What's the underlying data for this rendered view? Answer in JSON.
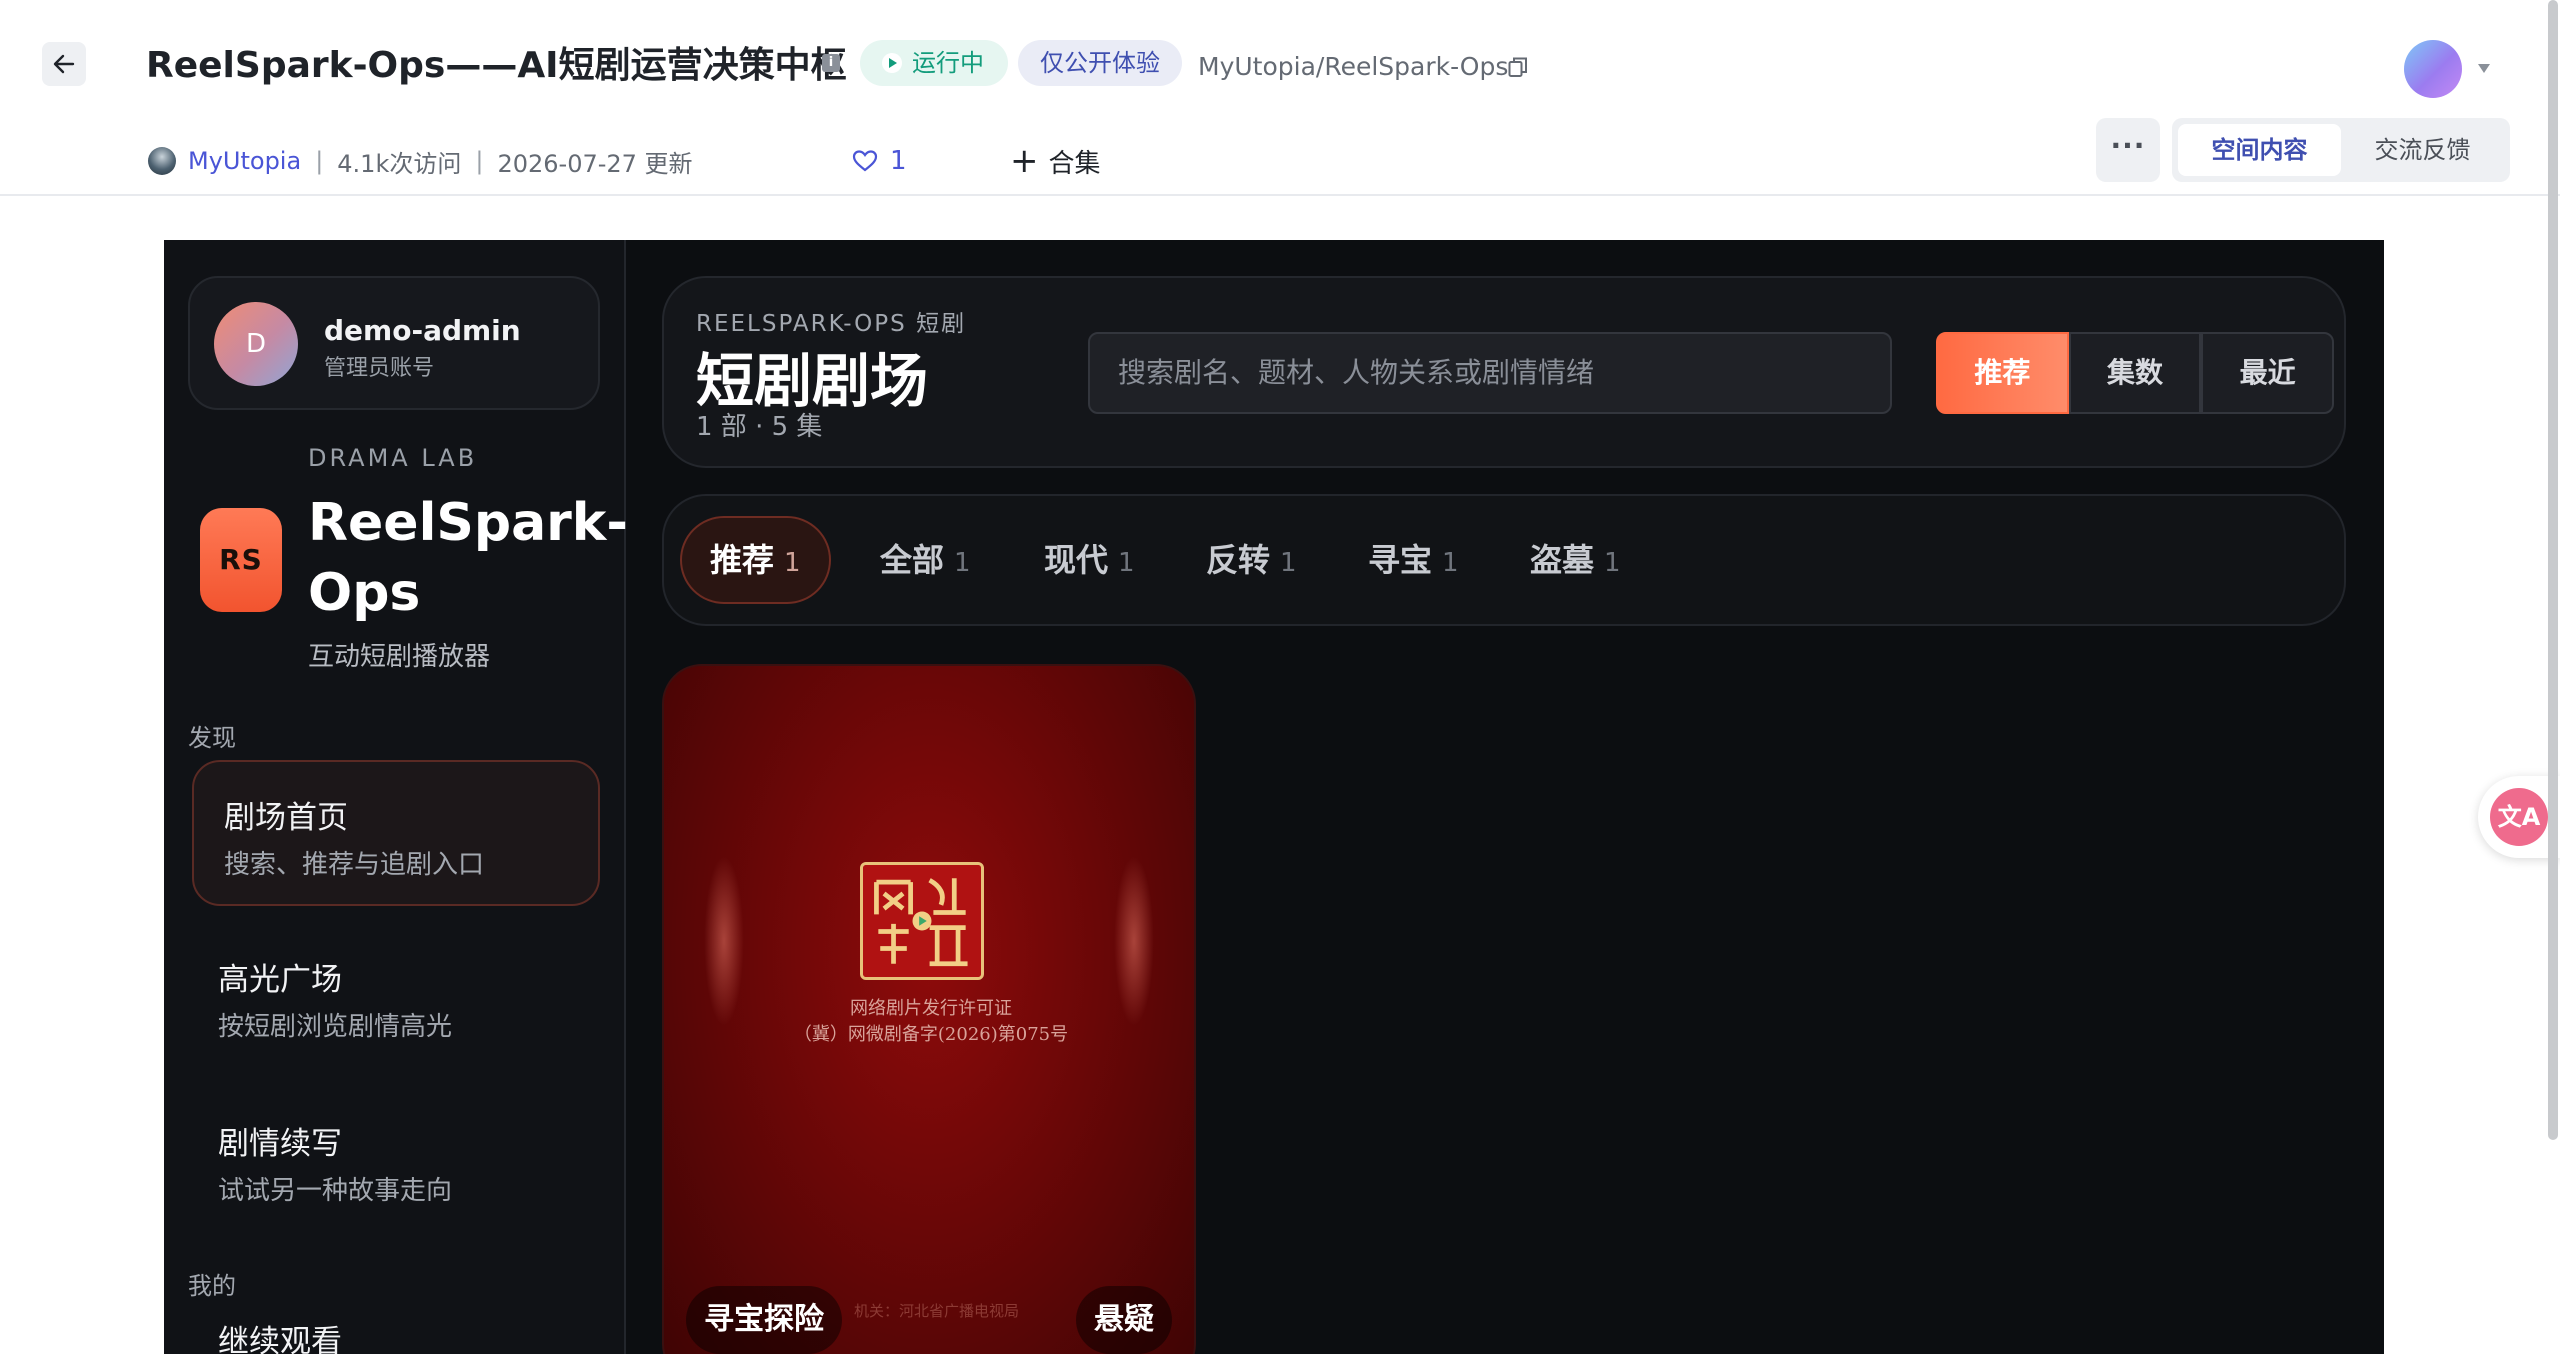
{
  "header": {
    "title": "ReelSpark-Ops——AI短剧运营决策中枢",
    "status": "运行中",
    "visibility": "仅公开体验",
    "repo_path": "MyUtopia/ReelSpark-Ops",
    "author": "MyUtopia",
    "visits": "4.1k次访问",
    "updated": "2026-07-27 更新",
    "likes": "1",
    "collection_label": "合集",
    "more_label": "···",
    "tabs": [
      "空间内容",
      "交流反馈"
    ],
    "active_tab": "空间内容"
  },
  "app": {
    "user": {
      "initial": "D",
      "name": "demo-admin",
      "role": "管理员账号"
    },
    "brand": {
      "kicker": "DRAMA LAB",
      "logo": "RS",
      "name": "ReelSpark-Ops",
      "subtitle": "互动短剧播放器"
    },
    "sections": {
      "discover": "发现",
      "mine": "我的"
    },
    "nav": [
      {
        "title": "剧场首页",
        "desc": "搜索、推荐与追剧入口",
        "active": true
      },
      {
        "title": "高光广场",
        "desc": "按短剧浏览剧情高光",
        "active": false
      },
      {
        "title": "剧情续写",
        "desc": "试试另一种故事走向",
        "active": false
      }
    ],
    "mine_first_item": "继续观看",
    "hero": {
      "kicker": "REELSPARK-OPS 短剧",
      "title": "短剧剧场",
      "count": "1 部 · 5 集",
      "search_placeholder": "搜索剧名、题材、人物关系或剧情情绪",
      "sort": [
        "推荐",
        "集数",
        "最近"
      ],
      "active_sort": "推荐"
    },
    "filters": [
      {
        "label": "推荐",
        "count": "1",
        "active": true
      },
      {
        "label": "全部",
        "count": "1",
        "active": false
      },
      {
        "label": "现代",
        "count": "1",
        "active": false
      },
      {
        "label": "反转",
        "count": "1",
        "active": false
      },
      {
        "label": "寻宝",
        "count": "1",
        "active": false
      },
      {
        "label": "盗墓",
        "count": "1",
        "active": false
      }
    ],
    "card": {
      "seal_text": "网络视听",
      "license_line_1": "网络剧片发行许可证",
      "license_line_2": "（冀）网微剧备字(2026)第075号",
      "license_line_3": "机关：河北省广播电视局",
      "tag_left": "寻宝探险",
      "tag_right": "悬疑"
    }
  },
  "colors": {
    "accent": "#ff6a42",
    "brand_blue": "#3f4fb0",
    "status_green": "#139c7c",
    "card_red": "#7a0909"
  },
  "icons": [
    "back-arrow-icon",
    "info-icon",
    "play-icon",
    "copy-icon",
    "heart-icon",
    "plus-icon",
    "more-icon",
    "translate-icon",
    "caret-down-icon"
  ]
}
